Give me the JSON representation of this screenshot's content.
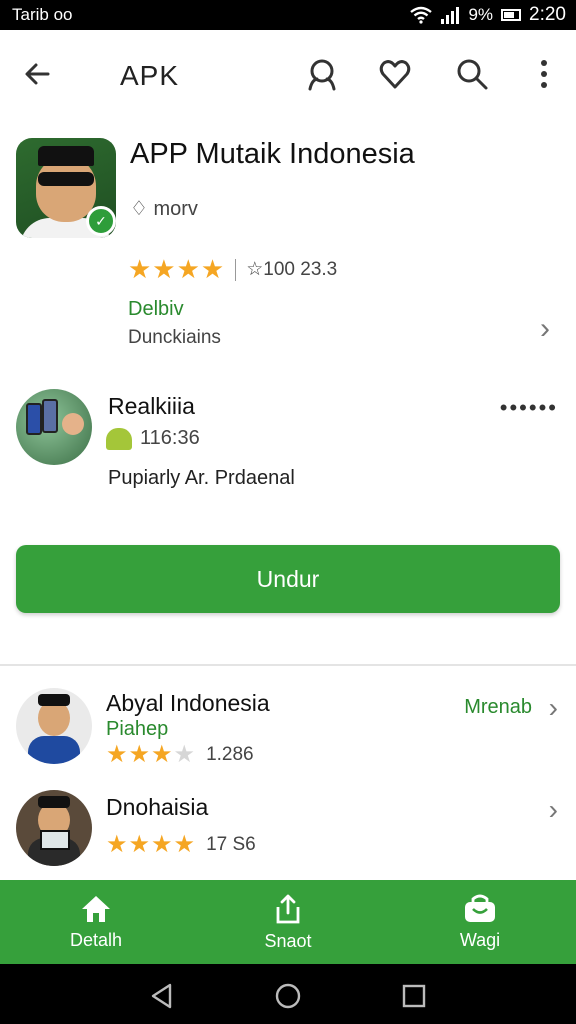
{
  "status_bar": {
    "left_text": "Tarib oo",
    "signal_text": "9%",
    "time": "2:20"
  },
  "app_bar": {
    "title": "APK",
    "icons": [
      "back-arrow-icon",
      "profile-search-icon",
      "heart-icon",
      "search-icon",
      "more-vert-icon"
    ]
  },
  "app": {
    "title": "APP Mutaik Indonesia",
    "developer": "♢ morv",
    "stars": "★★★★",
    "rating_count": "☆100 23.3",
    "info_label": "Delbiv",
    "info_sub": "Dunckiains"
  },
  "publisher": {
    "name": "Realkiiia",
    "meta": "116:36",
    "description": "Pupiarly Ar. Prdaenal",
    "more": "••••••"
  },
  "download": {
    "label": "Undur"
  },
  "related": [
    {
      "name": "Abyal Indonesia",
      "sub": "Piahep",
      "stars_full": "★★★",
      "stars_empty": "★",
      "count": "1.286",
      "action": "Mrenab"
    },
    {
      "name": "Dnohaisia",
      "stars_full": "★★★★",
      "stars_empty": "",
      "count": "17 S6"
    }
  ],
  "bottom_nav": [
    {
      "label": "Detalh",
      "icon": "home-icon"
    },
    {
      "label": "Snaot",
      "icon": "share-icon"
    },
    {
      "label": "Wagi",
      "icon": "bag-icon"
    }
  ],
  "colors": {
    "primary_green": "#36a03b",
    "star": "#f5a623",
    "link_green": "#2a8a2e"
  }
}
